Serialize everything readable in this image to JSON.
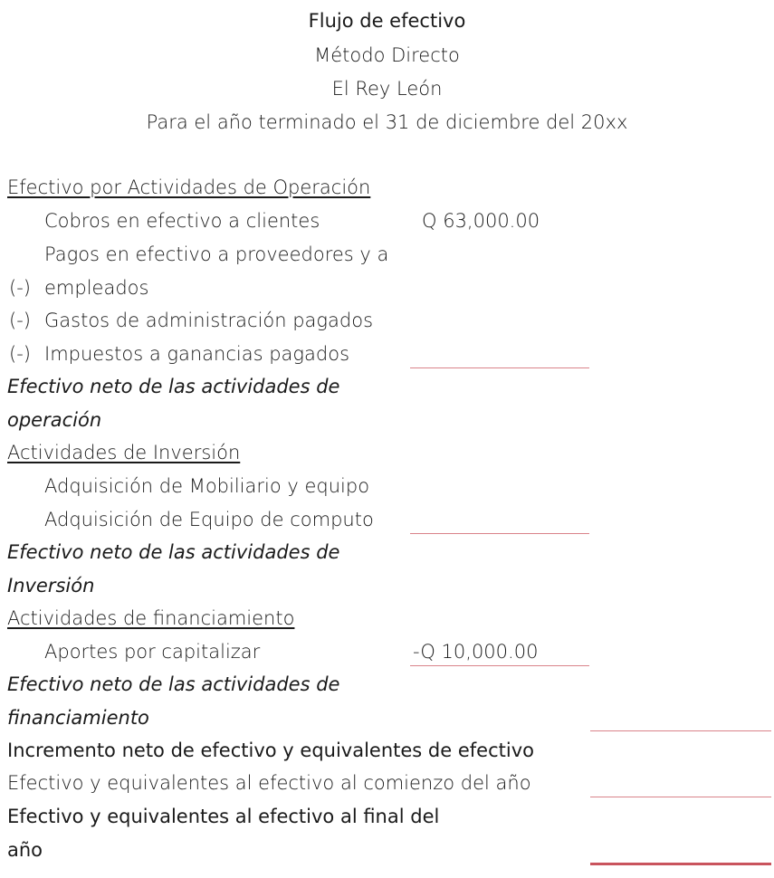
{
  "header": {
    "title": "Flujo de efectivo",
    "method": "Método Directo",
    "company": "El Rey León",
    "period": "Para el año terminado el 31 de diciembre del 20xx"
  },
  "operation": {
    "section_label": "Efectivo por Actividades de Operación",
    "cobros_label": "Cobros en efectivo a clientes",
    "cobros_amount": "Q  63,000.00",
    "pagos_label_line1": "Pagos en efectivo a proveedores y a",
    "pagos_sign": "(-)",
    "pagos_label_line2": "empleados",
    "gastos_sign": "(-)",
    "gastos_label": "Gastos de administración pagados",
    "impuestos_sign": "(-)",
    "impuestos_label": "Impuestos a ganancias pagados",
    "net_line1": "Efectivo neto de las actividades de",
    "net_line2": "operación"
  },
  "investment": {
    "section_label": "Actividades de Inversión",
    "mobiliario_label": "Adquisición de Mobiliario y equipo",
    "computo_label": "Adquisición de Equipo de computo",
    "net_line1": "Efectivo neto de las actividades de",
    "net_line2": "Inversión"
  },
  "financing": {
    "section_label": "Actividades de financiamiento",
    "aportes_label": "Aportes por capitalizar",
    "aportes_amount": "-Q  10,000.00",
    "net_line1": "Efectivo neto de las actividades de",
    "net_line2": "financiamiento"
  },
  "summary": {
    "increment_label": "Incremento neto de efectivo y equivalentes de efectivo",
    "beginning_label": "Efectivo y equivalentes al efectivo al comienzo del año",
    "ending_line1": "Efectivo y equivalentes al efectivo al final del",
    "ending_line2": "año"
  },
  "colors": {
    "rule": "#d9838a",
    "double_rule": "#c9545d",
    "text": "#1a1a1a"
  }
}
